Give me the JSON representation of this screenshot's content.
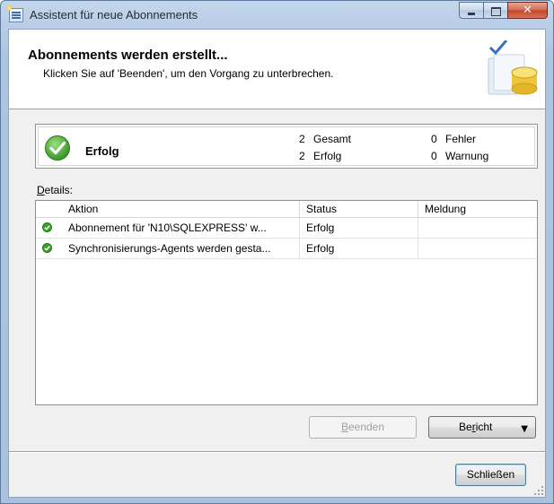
{
  "window": {
    "title": "Assistent für neue Abonnements"
  },
  "header": {
    "title": "Abonnements werden erstellt...",
    "subtitle": "Klicken Sie auf 'Beenden', um den Vorgang zu unterbrechen."
  },
  "summary": {
    "status": "Erfolg",
    "total_count": "2",
    "total_label": "Gesamt",
    "success_count": "2",
    "success_label": "Erfolg",
    "error_count": "0",
    "error_label": "Fehler",
    "warning_count": "0",
    "warning_label": "Warnung"
  },
  "details": {
    "label_underlined": "D",
    "label_rest": "etails:",
    "columns": [
      "Aktion",
      "Status",
      "Meldung"
    ],
    "rows": [
      {
        "action": "Abonnement für 'N10\\SQLEXPRESS' w...",
        "status": "Erfolg",
        "message": ""
      },
      {
        "action": "Synchronisierungs-Agents werden gesta...",
        "status": "Erfolg",
        "message": ""
      }
    ]
  },
  "buttons": {
    "stop_underlined": "B",
    "stop_rest": "eenden",
    "report_pre": "Be",
    "report_underlined": "r",
    "report_rest": "icht",
    "close": "Schließen"
  },
  "icons": {
    "success": "green-check-icon",
    "dropdown": "triangle-down-icon"
  },
  "colors": {
    "success_green": "#3aa02a",
    "titlebar": "#b8cde6",
    "close_button": "#c2462a"
  }
}
